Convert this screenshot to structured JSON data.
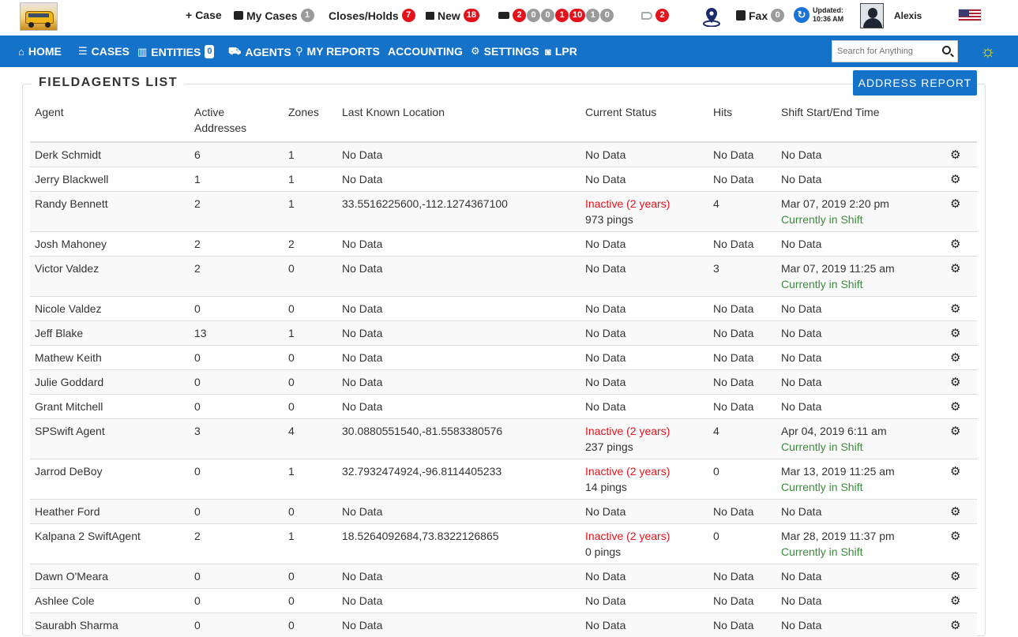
{
  "topbar": {
    "new_case": "Case",
    "my_cases": "My Cases",
    "my_cases_count": "1",
    "closes_holds": "Closes/Holds",
    "closes_holds_count": "7",
    "new": "New",
    "new_count": "18",
    "truck_counts": [
      "2",
      "0",
      "0",
      "1",
      "10",
      "1",
      "0"
    ],
    "announce_count": "2",
    "fax": "Fax",
    "fax_count": "0",
    "updated_label": "Updated:",
    "updated_time": "10:36 AM",
    "username": "Alexis"
  },
  "nav": {
    "home": "HOME",
    "cases": "CASES",
    "entities": "ENTITIES",
    "entities_count": "0",
    "agents": "AGENTS",
    "my_reports": "MY REPORTS",
    "accounting": "ACCOUNTING",
    "settings": "SETTINGS",
    "lpr": "LPR",
    "search_placeholder": "Search for Anything"
  },
  "page": {
    "title": "FIELDAGENTS LIST",
    "address_report": "ADDRESS REPORT"
  },
  "table": {
    "headers": [
      "Agent",
      "Active Addresses",
      "Zones",
      "Last Known Location",
      "Current Status",
      "Hits",
      "Shift Start/End Time"
    ],
    "rows": [
      {
        "agent": "Derk Schmidt",
        "addresses": "6",
        "zones": "1",
        "location": "No Data",
        "status": "No Data",
        "pings": "",
        "hits": "No Data",
        "shift": "No Data",
        "shift_note": ""
      },
      {
        "agent": "Jerry Blackwell",
        "addresses": "1",
        "zones": "1",
        "location": "No Data",
        "status": "No Data",
        "pings": "",
        "hits": "No Data",
        "shift": "No Data",
        "shift_note": ""
      },
      {
        "agent": "Randy Bennett",
        "addresses": "2",
        "zones": "1",
        "location": "33.5516225600,-112.1274367100",
        "status": "Inactive (2 years)",
        "pings": "973 pings",
        "hits": "4",
        "shift": "Mar 07, 2019 2:20 pm",
        "shift_note": "Currently in Shift"
      },
      {
        "agent": "Josh Mahoney",
        "addresses": "2",
        "zones": "2",
        "location": "No Data",
        "status": "No Data",
        "pings": "",
        "hits": "No Data",
        "shift": "No Data",
        "shift_note": ""
      },
      {
        "agent": "Victor Valdez",
        "addresses": "2",
        "zones": "0",
        "location": "No Data",
        "status": "No Data",
        "pings": "",
        "hits": "3",
        "shift": "Mar 07, 2019 11:25 am",
        "shift_note": "Currently in Shift"
      },
      {
        "agent": "Nicole Valdez",
        "addresses": "0",
        "zones": "0",
        "location": "No Data",
        "status": "No Data",
        "pings": "",
        "hits": "No Data",
        "shift": "No Data",
        "shift_note": ""
      },
      {
        "agent": "Jeff Blake",
        "addresses": "13",
        "zones": "1",
        "location": "No Data",
        "status": "No Data",
        "pings": "",
        "hits": "No Data",
        "shift": "No Data",
        "shift_note": ""
      },
      {
        "agent": "Mathew Keith",
        "addresses": "0",
        "zones": "0",
        "location": "No Data",
        "status": "No Data",
        "pings": "",
        "hits": "No Data",
        "shift": "No Data",
        "shift_note": ""
      },
      {
        "agent": "Julie Goddard",
        "addresses": "0",
        "zones": "0",
        "location": "No Data",
        "status": "No Data",
        "pings": "",
        "hits": "No Data",
        "shift": "No Data",
        "shift_note": ""
      },
      {
        "agent": "Grant Mitchell",
        "addresses": "0",
        "zones": "0",
        "location": "No Data",
        "status": "No Data",
        "pings": "",
        "hits": "No Data",
        "shift": "No Data",
        "shift_note": ""
      },
      {
        "agent": "SPSwift Agent",
        "addresses": "3",
        "zones": "4",
        "location": "30.0880551540,-81.5583380576",
        "status": "Inactive (2 years)",
        "pings": "237 pings",
        "hits": "4",
        "shift": "Apr 04, 2019 6:11 am",
        "shift_note": "Currently in Shift"
      },
      {
        "agent": "Jarrod DeBoy",
        "addresses": "0",
        "zones": "1",
        "location": "32.7932474924,-96.8114405233",
        "status": "Inactive (2 years)",
        "pings": "14 pings",
        "hits": "0",
        "shift": "Mar 13, 2019 11:25 am",
        "shift_note": "Currently in Shift"
      },
      {
        "agent": "Heather Ford",
        "addresses": "0",
        "zones": "0",
        "location": "No Data",
        "status": "No Data",
        "pings": "",
        "hits": "No Data",
        "shift": "No Data",
        "shift_note": ""
      },
      {
        "agent": "Kalpana 2 SwiftAgent",
        "addresses": "2",
        "zones": "1",
        "location": "18.5264092684,73.8322126865",
        "status": "Inactive (2 years)",
        "pings": "0 pings",
        "hits": "0",
        "shift": "Mar 28, 2019 11:37 pm",
        "shift_note": "Currently in Shift"
      },
      {
        "agent": "Dawn O'Meara",
        "addresses": "0",
        "zones": "0",
        "location": "No Data",
        "status": "No Data",
        "pings": "",
        "hits": "No Data",
        "shift": "No Data",
        "shift_note": ""
      },
      {
        "agent": "Ashlee Cole",
        "addresses": "0",
        "zones": "0",
        "location": "No Data",
        "status": "No Data",
        "pings": "",
        "hits": "No Data",
        "shift": "No Data",
        "shift_note": ""
      },
      {
        "agent": "Saurabh Sharma",
        "addresses": "0",
        "zones": "0",
        "location": "No Data",
        "status": "No Data",
        "pings": "",
        "hits": "No Data",
        "shift": "No Data",
        "shift_note": ""
      }
    ]
  },
  "colors": {
    "brand_blue": "#1572c9",
    "badge_red": "#e5121b",
    "inactive_red": "#e5121b",
    "shift_green": "#3c8a3c"
  }
}
